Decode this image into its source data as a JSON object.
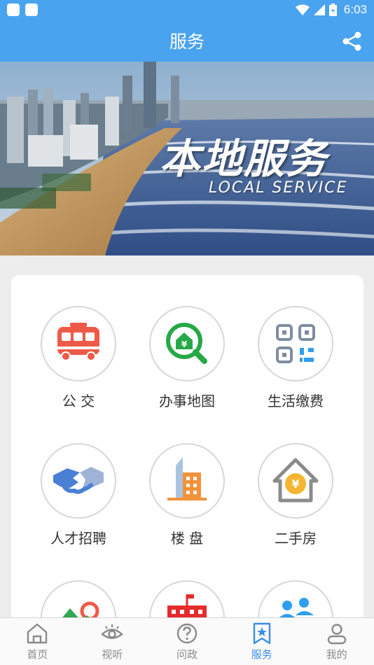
{
  "status_bar": {
    "time": "6:03"
  },
  "header": {
    "title": "服务"
  },
  "banner": {
    "title": "本地服务",
    "subtitle": "LOCAL SERVICE"
  },
  "services": [
    {
      "label": "公 交",
      "icon": "bus-icon"
    },
    {
      "label": "办事地图",
      "icon": "map-search-icon"
    },
    {
      "label": "生活缴费",
      "icon": "qr-code-icon"
    },
    {
      "label": "人才招聘",
      "icon": "handshake-icon"
    },
    {
      "label": "楼 盘",
      "icon": "building-icon"
    },
    {
      "label": "二手房",
      "icon": "house-yuan-icon"
    }
  ],
  "tabs": [
    {
      "label": "首页",
      "icon": "home-icon"
    },
    {
      "label": "视听",
      "icon": "eye-icon"
    },
    {
      "label": "问政",
      "icon": "question-icon"
    },
    {
      "label": "服务",
      "icon": "bookmark-star-icon",
      "active": true
    },
    {
      "label": "我的",
      "icon": "user-icon"
    }
  ],
  "colors": {
    "header": "#4aa3ee",
    "tab_active": "#3a8ee6",
    "tab_inactive": "#8a8a8a"
  }
}
